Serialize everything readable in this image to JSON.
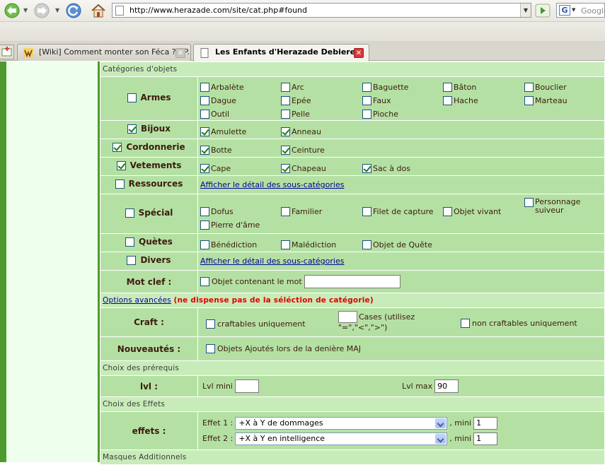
{
  "browser": {
    "url": "http://www.herazade.com/site/cat.php#found",
    "search_placeholder": "Google",
    "tabs": [
      {
        "title": "[Wiki] Comment monter son Féca ? - P...",
        "active": false
      },
      {
        "title": "Les Enfants d'Herazade Debiere ::",
        "active": true
      }
    ]
  },
  "form": {
    "sections": {
      "categories": "Catégories d'objets",
      "options_link": "Options avancées",
      "options_warning": "(ne dispense pas de la séléction de catégorie)",
      "prereq": "Choix des prérequis",
      "effects": "Choix des Effets",
      "masks": "Masques Additionnels"
    },
    "armes": {
      "label": "Armes",
      "checked": false,
      "items": [
        "Arbalète",
        "Arc",
        "Baguette",
        "Bâton",
        "Bouclier",
        "Dague",
        "Epée",
        "Faux",
        "Hache",
        "Marteau",
        "Outil",
        "Pelle",
        "Pioche"
      ]
    },
    "bijoux": {
      "label": "Bijoux",
      "checked": true,
      "items": [
        "Amulette",
        "Anneau"
      ]
    },
    "cordonnerie": {
      "label": "Cordonnerie",
      "checked": true,
      "items": [
        "Botte",
        "Ceinture"
      ]
    },
    "vetements": {
      "label": "Vetements",
      "checked": true,
      "items": [
        "Cape",
        "Chapeau",
        "Sac à dos"
      ]
    },
    "ressources": {
      "label": "Ressources",
      "checked": false,
      "link": "Afficher le détail des sous-catégories"
    },
    "special": {
      "label": "Spécial",
      "checked": false,
      "items": [
        "Dofus",
        "Familier",
        "Filet de capture",
        "Objet vivant",
        "Personnage suiveur",
        "Pierre d'âme"
      ]
    },
    "quetes": {
      "label": "Quètes",
      "checked": false,
      "items": [
        "Bénédiction",
        "Malédiction",
        "Objet de Quête"
      ]
    },
    "divers": {
      "label": "Divers",
      "checked": false,
      "link": "Afficher le détail des sous-catégories"
    },
    "motclef": {
      "label": "Mot clef :",
      "option": "Objet contenant le mot",
      "value": ""
    },
    "craft": {
      "label": "Craft :",
      "craftables": "craftables uniquement",
      "cases_label": "Cases (utilisez",
      "cases_hint": "\"=\",\"<\",\">\")",
      "cases_value": "",
      "non_craftables": "non craftables uniquement"
    },
    "nouveautes": {
      "label": "Nouveautés :",
      "option": "Objets Ajoutés lors de la denière MAJ"
    },
    "lvl": {
      "label": "lvl :",
      "min_label": "Lvl mini",
      "min_value": "",
      "max_label": "Lvl max",
      "max_value": "90"
    },
    "effets": {
      "label": "effets :",
      "rows": [
        {
          "label": "Effet 1 :",
          "selected": "+X à Y de dommages",
          "mini_label": ", mini",
          "mini_value": "1"
        },
        {
          "label": "Effet 2 :",
          "selected": "+X à Y en intelligence",
          "mini_label": ", mini",
          "mini_value": "1"
        }
      ]
    }
  },
  "colors": {
    "row_bg": "#b4e1a3",
    "section_bg": "#c8ecb9",
    "label_text": "#3d1a0f",
    "left_stripe": "#4e9a2e",
    "left_panel": "#efffee",
    "warning": "#e00000",
    "link": "#000099"
  }
}
